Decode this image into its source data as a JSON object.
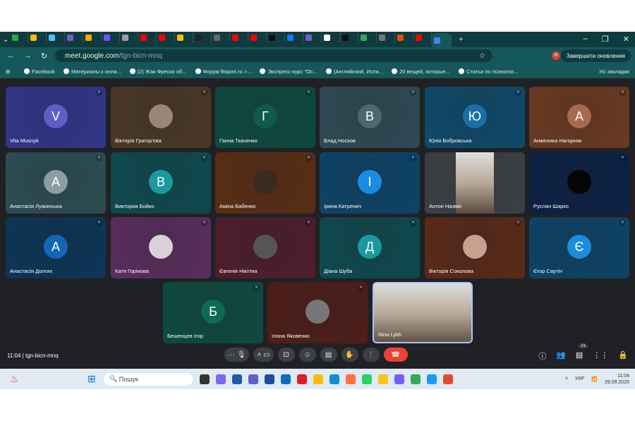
{
  "browser": {
    "url_host": "meet.google.com",
    "url_path": "/tgn-bicn-mnq",
    "update_button": "Завершити оновлення",
    "profile_initial": "N",
    "tab_colors": [
      "#2da44e",
      "#fbbc04",
      "#4fc3f7",
      "#7e57c2",
      "#f9ab00",
      "#7c4dff",
      "#9e9e9e",
      "#ff0000",
      "#ff0000",
      "#fbbc04",
      "#222",
      "#666",
      "#ff0000",
      "#ff0000",
      "#111",
      "#1877f2",
      "#7e57c2",
      "#ffffff",
      "#111",
      "#34a853",
      "#777",
      "#e65100",
      "#ff0000",
      "#4285f4"
    ],
    "bookmarks": [
      "Facebook",
      "Материалы к онла...",
      "(2) Жак Фреско об...",
      "Форум fitsport.ru >...",
      "Экспресс-курс \"Ос...",
      "(Английский, Испа...",
      "20 вещей, которые...",
      "Статьи по психолог..."
    ],
    "all_bookmarks": "Усі закладки"
  },
  "participants": [
    {
      "name": "Vita Musnyk",
      "initial": "V",
      "bg": "#33358a",
      "av": "#5c5fc4"
    },
    {
      "name": "Вікторія Григор'єва",
      "initial": "",
      "bg": "#4a3826",
      "av": "#9a8577"
    },
    {
      "name": "Ганна Ткаченко",
      "initial": "Г",
      "bg": "#0e4a40",
      "av": "#0e5a4c"
    },
    {
      "name": "Влад Носков",
      "initial": "В",
      "bg": "#2f4a55",
      "av": "#4d6670"
    },
    {
      "name": "Юлія Бобровська",
      "initial": "Ю",
      "bg": "#0f4a6a",
      "av": "#1b6fa8"
    },
    {
      "name": "Анжелика Нагорняк",
      "initial": "А",
      "bg": "#6a3a22",
      "av": "#a66a4c"
    },
    {
      "name": "Анастасія Лужинська",
      "initial": "А",
      "bg": "#2c4d52",
      "av": "#8a9ea3"
    },
    {
      "name": "Виктория Бойко",
      "initial": "В",
      "bg": "#0e4a50",
      "av": "#1a9aa0"
    },
    {
      "name": "Аміна Бабенко",
      "initial": "",
      "bg": "#5a2e14",
      "av": "#3a2a20"
    },
    {
      "name": "Ірина Катренич",
      "initial": "І",
      "bg": "#0d4468",
      "av": "#1a8de0"
    },
    {
      "name": "Антон Назміє",
      "initial": "",
      "bg": "#3c4043",
      "av": "",
      "video": true
    },
    {
      "name": "Руслан Шарко",
      "initial": "",
      "bg": "#0b2145",
      "av": "#050505"
    },
    {
      "name": "Анастасія Долгих",
      "initial": "А",
      "bg": "#0d3558",
      "av": "#1266b5"
    },
    {
      "name": "Катя Горінова",
      "initial": "",
      "bg": "#5a2d5e",
      "av": "#d9d0d8"
    },
    {
      "name": "Євгенія Нікітіна",
      "initial": "",
      "bg": "#4e1e2c",
      "av": "#555"
    },
    {
      "name": "Діана Шуба",
      "initial": "Д",
      "bg": "#0e4a50",
      "av": "#1a9aa0"
    },
    {
      "name": "Вікторія Соколова",
      "initial": "",
      "bg": "#5a2a18",
      "av": "#c8a090"
    },
    {
      "name": "Єгор Саутін",
      "initial": "Є",
      "bg": "#0d4468",
      "av": "#1a8de0"
    },
    {
      "name": "Бешенцев Ігор",
      "initial": "Б",
      "bg": "#0e4a40",
      "av": "#0f6a52"
    },
    {
      "name": "Ілона Яковенко",
      "initial": "",
      "bg": "#4e1e1a",
      "av": "#777"
    },
    {
      "name": "Nina Lykh",
      "initial": "",
      "bg": "#d9d4ce",
      "av": "",
      "video": true
    }
  ],
  "meeting": {
    "time": "11:04",
    "code": "tgn-bicn-mnq",
    "participant_count": "21",
    "end_call_color": "#ea4335"
  },
  "taskbar": {
    "search_placeholder": "Пошук",
    "lang": "УКР",
    "time": "11:04",
    "date": "29.09.2025",
    "app_colors": [
      "#333",
      "#7b68ee",
      "#1e5aa8",
      "#5b5fc7",
      "#1f4e99",
      "#0f6cbd",
      "#e01b24",
      "#fbbc04",
      "#0c8ed9",
      "#ff7139",
      "#25d366",
      "#f5c518",
      "#7360f2",
      "#34a853",
      "#1d9bf0",
      "#e04a2f"
    ]
  }
}
